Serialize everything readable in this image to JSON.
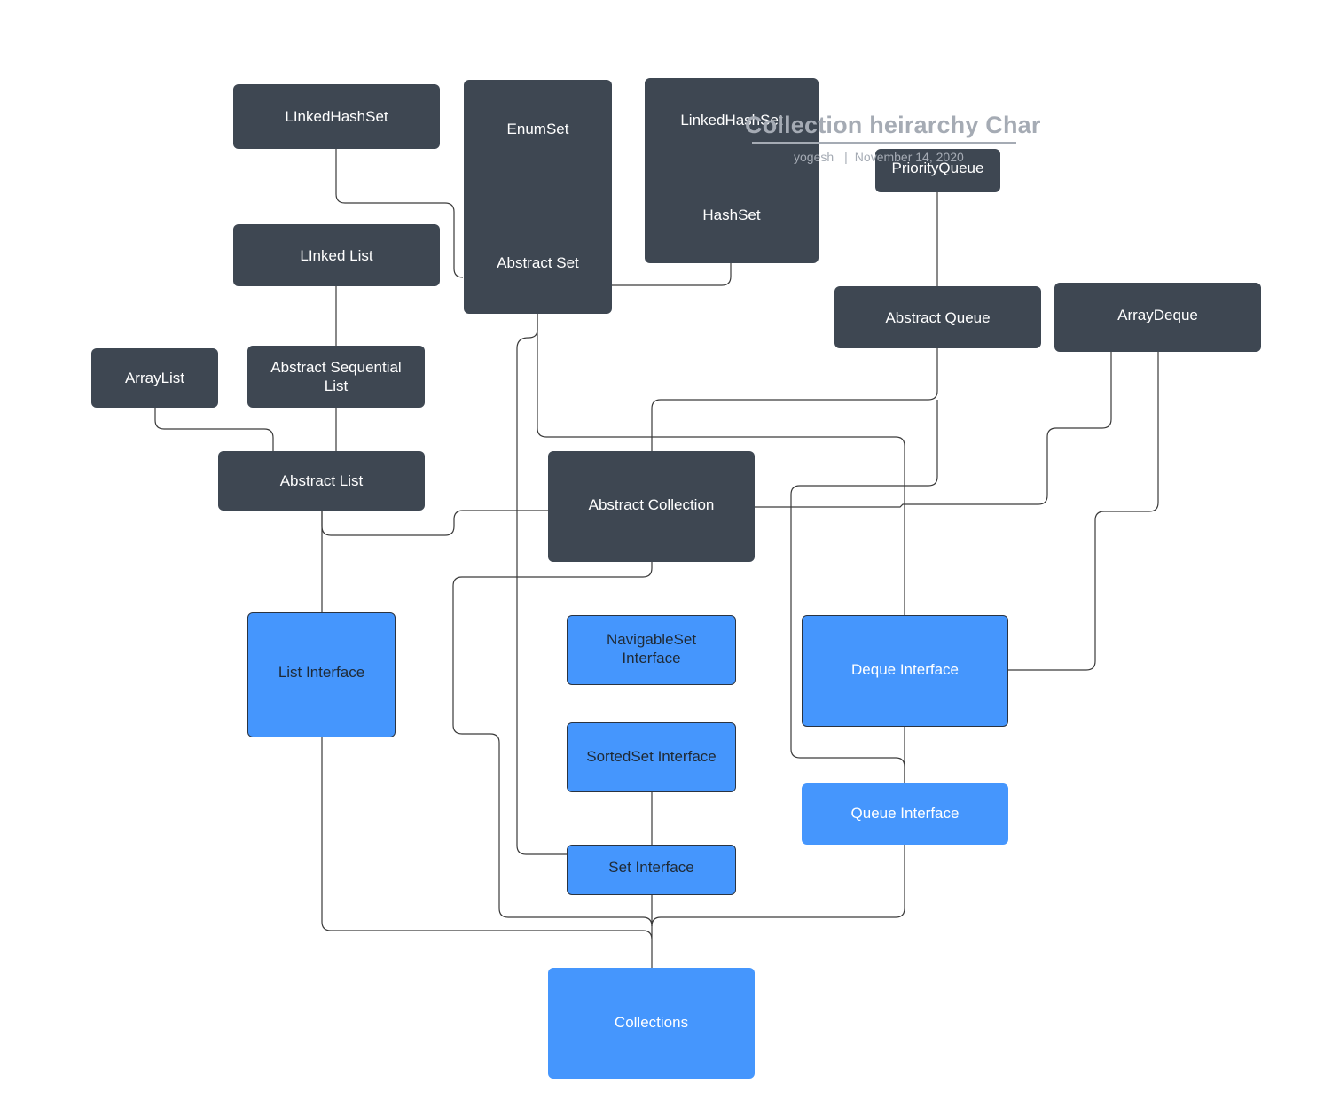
{
  "document": {
    "title": "Collection heirarchy Char",
    "author": "yogesh",
    "separator": "|",
    "date": "November 14, 2020"
  },
  "colors": {
    "class_node": "#3e4752",
    "interface_node": "#4596fd",
    "connector": "#3a3a3a",
    "title_text": "#a5abb4"
  },
  "nodes": {
    "linked_hash_set_left": "LInkedHashSet",
    "enum_set": "EnumSet",
    "abstract_set": "Abstract Set",
    "linked_hash_set_right": "LinkedHashSet",
    "hash_set": "HashSet",
    "priority_queue": "PriorityQueue",
    "linked_list": "LInked List",
    "abstract_queue": "Abstract Queue",
    "array_deque": "ArrayDeque",
    "array_list": "ArrayList",
    "abstract_sequential_list": "Abstract Sequential\nList",
    "abstract_list": "Abstract List",
    "abstract_collection": "Abstract Collection",
    "list_interface": "List Interface",
    "navigable_set_interface": "NavigableSet\nInterface",
    "sorted_set_interface": "SortedSet Interface",
    "set_interface": "Set Interface",
    "deque_interface": "Deque Interface",
    "queue_interface": "Queue Interface",
    "collections": "Collections"
  },
  "edges": [
    {
      "from": "LInkedHashSet",
      "to": "Abstract Set"
    },
    {
      "from": "HashSet",
      "to": "Abstract Set"
    },
    {
      "from": "LInked List",
      "to": "Abstract Sequential List"
    },
    {
      "from": "Abstract Sequential List",
      "to": "Abstract List"
    },
    {
      "from": "ArrayList",
      "to": "Abstract List"
    },
    {
      "from": "PriorityQueue",
      "to": "Abstract Queue"
    },
    {
      "from": "Abstract Queue",
      "to": "Abstract Collection"
    },
    {
      "from": "Abstract Queue",
      "to": "Queue Interface"
    },
    {
      "from": "ArrayDeque",
      "to": "Abstract Collection"
    },
    {
      "from": "ArrayDeque",
      "to": "Deque Interface"
    },
    {
      "from": "Abstract Set",
      "to": "Set Interface"
    },
    {
      "from": "Abstract Set",
      "to": "Deque Interface"
    },
    {
      "from": "Abstract Collection",
      "to": "Abstract List"
    },
    {
      "from": "Abstract Collection",
      "to": "Collections"
    },
    {
      "from": "Abstract List",
      "to": "List Interface"
    },
    {
      "from": "List Interface",
      "to": "Collections"
    },
    {
      "from": "SortedSet Interface",
      "to": "Set Interface"
    },
    {
      "from": "Set Interface",
      "to": "Collections"
    },
    {
      "from": "Deque Interface",
      "to": "Queue Interface"
    },
    {
      "from": "Queue Interface",
      "to": "Collections"
    }
  ]
}
